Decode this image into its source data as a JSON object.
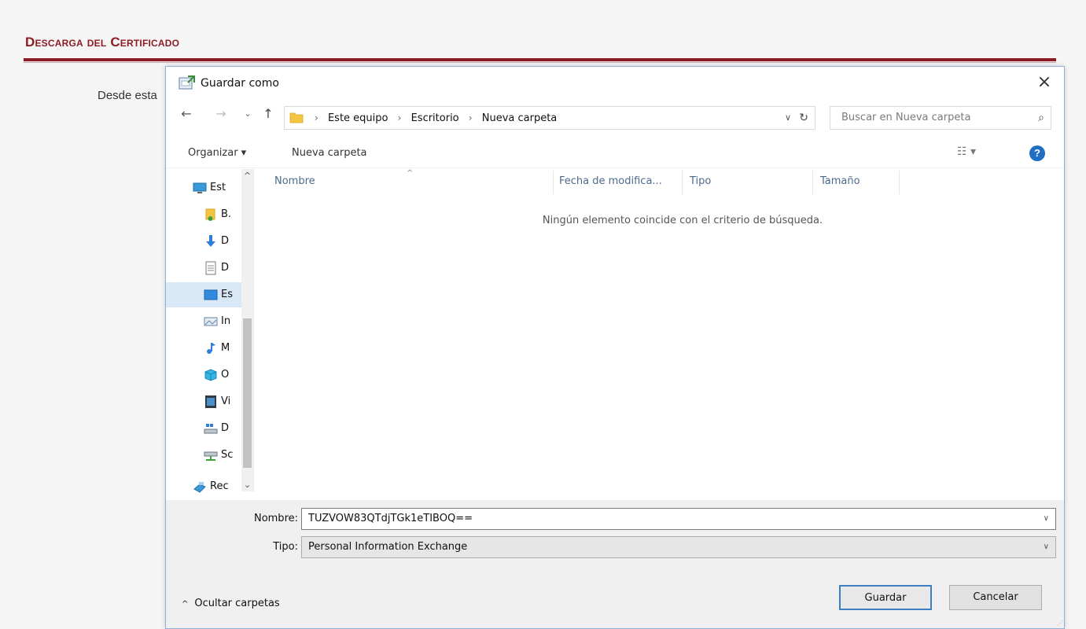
{
  "page": {
    "heading": "Descarga del Certificado",
    "body_text": "Desde esta"
  },
  "dialog": {
    "title": "Guardar como",
    "close_label": "×",
    "nav": {
      "back": "←",
      "forward": "→",
      "recent": "⌄",
      "up": "↑"
    },
    "address": {
      "crumbs": [
        "Este equipo",
        "Escritorio",
        "Nueva carpeta"
      ],
      "separator": "›",
      "dropdown": "∨",
      "refresh": "↻"
    },
    "search": {
      "placeholder": "Buscar en Nueva carpeta",
      "icon": "⌕"
    },
    "toolbar": {
      "organize": "Organizar ▾",
      "new_folder": "Nueva carpeta",
      "view": "☷ ▾",
      "help": "?"
    },
    "nav_pane": {
      "items": [
        {
          "label": "Est",
          "icon": "computer-icon"
        },
        {
          "label": "B.",
          "icon": "user-folder-icon"
        },
        {
          "label": "D",
          "icon": "downloads-icon"
        },
        {
          "label": "D",
          "icon": "documents-icon"
        },
        {
          "label": "Es",
          "icon": "desktop-icon"
        },
        {
          "label": "In",
          "icon": "pictures-icon"
        },
        {
          "label": "M",
          "icon": "music-icon"
        },
        {
          "label": "O",
          "icon": "3d-objects-icon"
        },
        {
          "label": "Vi",
          "icon": "videos-icon"
        },
        {
          "label": "D",
          "icon": "local-disk-icon"
        },
        {
          "label": "Sc",
          "icon": "network-drive-icon"
        },
        {
          "label": "Rec",
          "icon": "network-icon"
        }
      ],
      "selected_index": 4,
      "scroll_up": "^",
      "scroll_down": "⌄"
    },
    "columns": {
      "name": "Nombre",
      "date": "Fecha de modifica...",
      "type": "Tipo",
      "size": "Tamaño",
      "sort_caret": "^"
    },
    "empty_message": "Ningún elemento coincide con el criterio de búsqueda.",
    "filename": {
      "label": "Nombre:",
      "value": "TUZVOW83QTdjTGk1eTIBOQ=="
    },
    "filetype": {
      "label": "Tipo:",
      "value": "Personal Information Exchange"
    },
    "dropdown_arrow": "∨",
    "hide_folders": {
      "caret": "^",
      "label": "Ocultar carpetas"
    },
    "buttons": {
      "save": "Guardar",
      "cancel": "Cancelar"
    }
  },
  "colors": {
    "accent": "#8c1c24",
    "selection": "#d9e8f7",
    "primary_button_border": "#3b7fc4",
    "help_blue": "#1e6fc4"
  }
}
